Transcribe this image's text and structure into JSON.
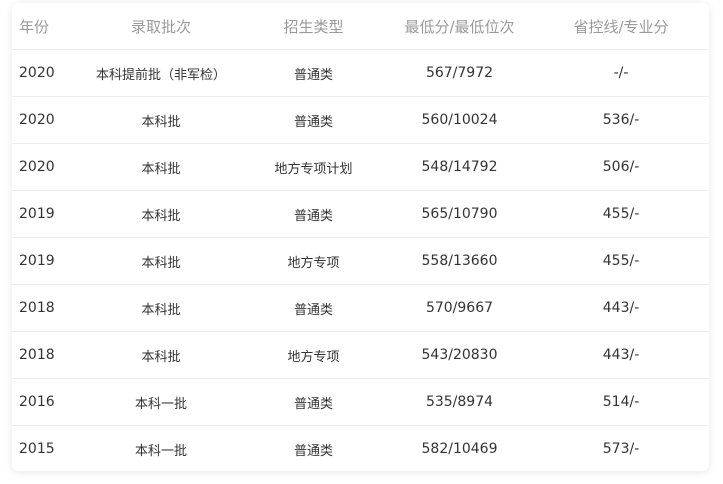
{
  "table": {
    "headers": [
      "年份",
      "录取批次",
      "招生类型",
      "最低分/最低位次",
      "省控线/专业分"
    ],
    "rows": [
      [
        "2020",
        "本科提前批（非军检）",
        "普通类",
        "567/7972",
        "-/-"
      ],
      [
        "2020",
        "本科批",
        "普通类",
        "560/10024",
        "536/-"
      ],
      [
        "2020",
        "本科批",
        "地方专项计划",
        "548/14792",
        "506/-"
      ],
      [
        "2019",
        "本科批",
        "普通类",
        "565/10790",
        "455/-"
      ],
      [
        "2019",
        "本科批",
        "地方专项",
        "558/13660",
        "455/-"
      ],
      [
        "2018",
        "本科批",
        "普通类",
        "570/9667",
        "443/-"
      ],
      [
        "2018",
        "本科批",
        "地方专项",
        "543/20830",
        "443/-"
      ],
      [
        "2016",
        "本科一批",
        "普通类",
        "535/8974",
        "514/-"
      ],
      [
        "2015",
        "本科一批",
        "普通类",
        "582/10469",
        "573/-"
      ]
    ]
  }
}
